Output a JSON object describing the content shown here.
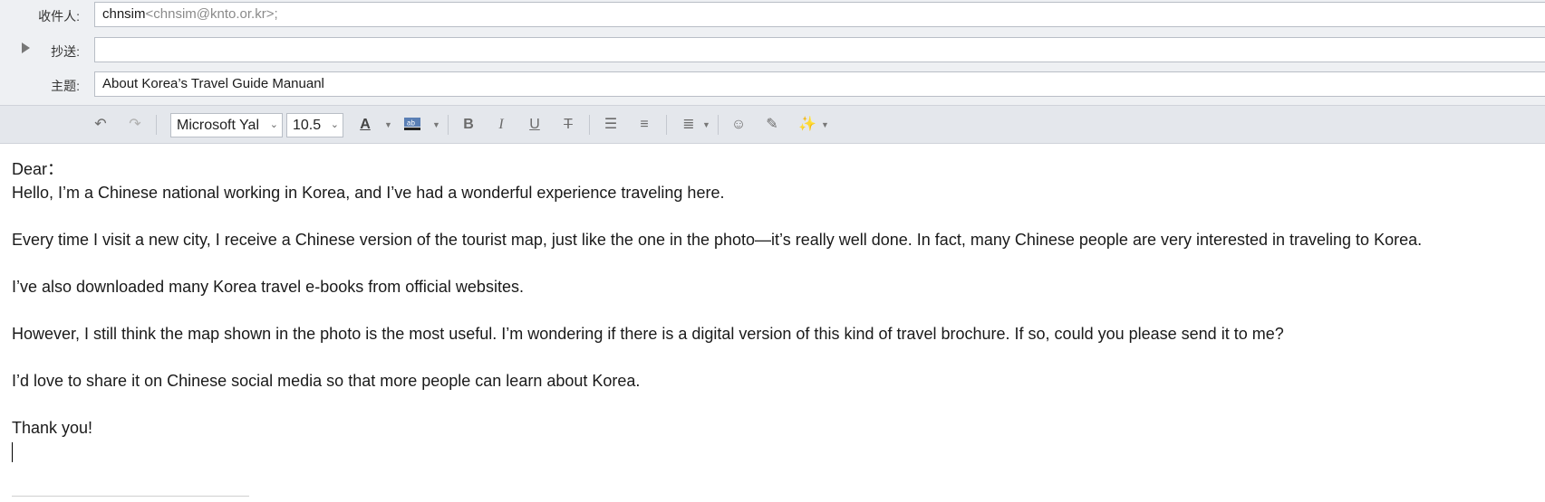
{
  "header": {
    "to": {
      "label": "收件人:",
      "name": "chnsim",
      "address": "<chnsim@knto.or.kr>;"
    },
    "cc": {
      "label": "抄送:",
      "value": ""
    },
    "subject": {
      "label": "主题:",
      "value": "About Korea’s Travel Guide Manuanl"
    }
  },
  "toolbar": {
    "font_family": "Microsoft Yal",
    "font_size": "10.5",
    "icons": [
      "undo-icon",
      "redo-icon",
      "font-color-icon",
      "highlight-color-icon",
      "bold-icon",
      "italic-icon",
      "underline-icon",
      "strikethrough-icon",
      "bullet-list-icon",
      "numbered-list-icon",
      "align-icon",
      "emoji-icon",
      "format-painter-icon",
      "magic-wand-icon"
    ]
  },
  "body": {
    "greeting": "Dear：",
    "lines": [
      "Hello, I’m a Chinese national working in Korea, and I’ve had a wonderful experience traveling here.",
      "Every time I visit a new city, I receive a Chinese version of the tourist map, just like the one in the photo—it’s really well done. In fact, many Chinese people are very interested in traveling to Korea.",
      "I’ve also downloaded many Korea travel e-books from official websites.",
      "However, I still think the map shown in the photo is the most useful. I’m wondering if there is a digital version of this kind of travel brochure. If so, could you please send it to me?",
      "I’d love to share it on Chinese social media so that more people can learn about Korea.",
      "Thank you!"
    ]
  }
}
